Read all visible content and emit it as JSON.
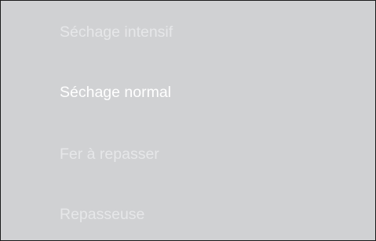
{
  "drying_menu": {
    "items": [
      {
        "label": "Séchage intensif",
        "selected": false
      },
      {
        "label": "Séchage normal",
        "selected": true
      },
      {
        "label": "Fer à repasser",
        "selected": false
      },
      {
        "label": "Repasseuse",
        "selected": false
      }
    ]
  },
  "colors": {
    "background": "#d0d1d3",
    "selected_text": "#ffffff",
    "unselected_text": "#e6e7e9",
    "border": "#1a1a1a"
  }
}
